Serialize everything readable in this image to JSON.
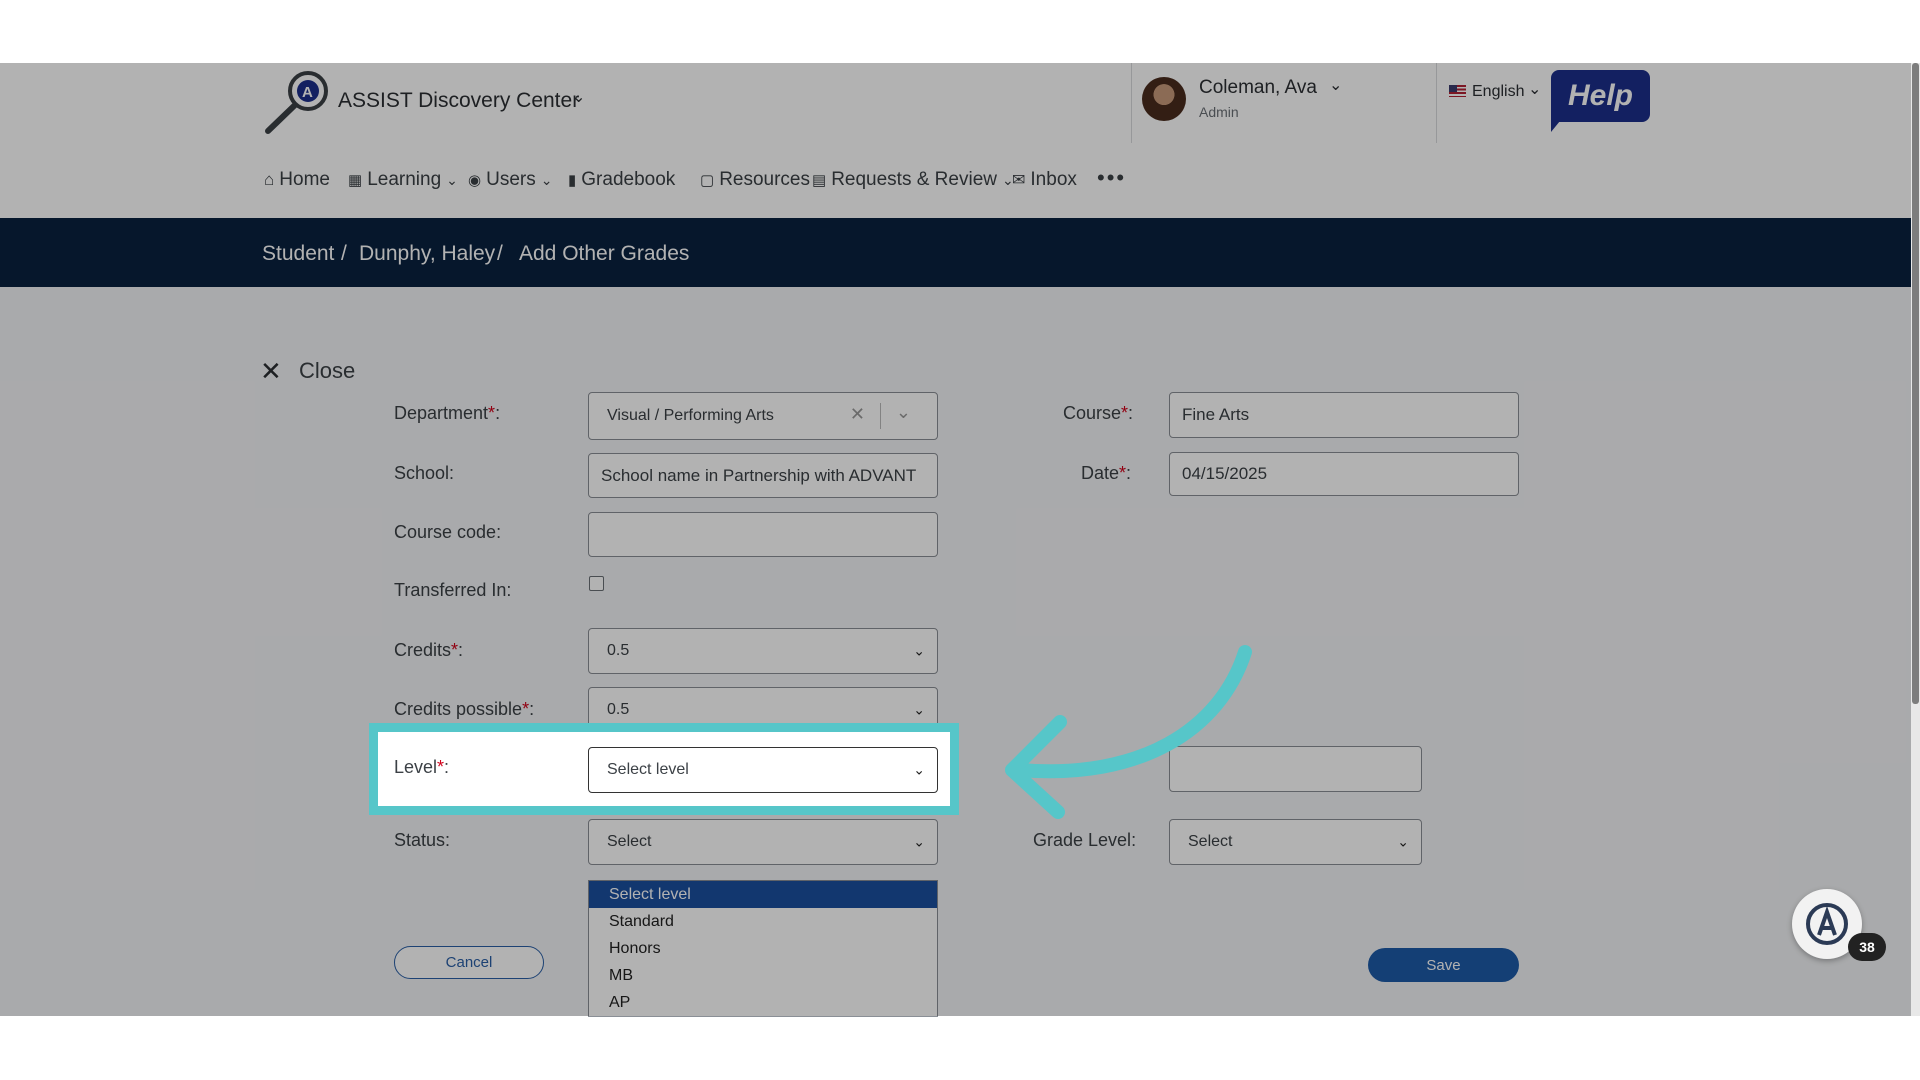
{
  "app": {
    "title": "ASSIST Discovery Center",
    "user_name": "Coleman, Ava",
    "user_role": "Admin",
    "language": "English",
    "help_label": "Help"
  },
  "nav": {
    "items": [
      {
        "label": "Home",
        "icon": "home-icon"
      },
      {
        "label": "Learning",
        "icon": "learning-icon"
      },
      {
        "label": "Users",
        "icon": "users-icon"
      },
      {
        "label": "Gradebook",
        "icon": "gradebook-icon"
      },
      {
        "label": "Resources",
        "icon": "resources-icon"
      },
      {
        "label": "Requests & Review",
        "icon": "requests-icon"
      },
      {
        "label": "Inbox",
        "icon": "inbox-icon"
      }
    ],
    "more": "•••"
  },
  "breadcrumb": {
    "parts": [
      "Student",
      "Dunphy, Haley",
      "Add Other Grades"
    ],
    "sep": "/"
  },
  "form": {
    "close_label": "Close",
    "department": {
      "label": "Department",
      "value": "Visual / Performing Arts"
    },
    "course": {
      "label": "Course",
      "value": "Fine Arts"
    },
    "school": {
      "label": "School",
      "value": "School name in Partnership with ADVANT"
    },
    "date": {
      "label": "Date",
      "value": "04/15/2025"
    },
    "course_code": {
      "label": "Course code",
      "value": ""
    },
    "transferred_in": {
      "label": "Transferred In",
      "checked": false
    },
    "credits": {
      "label": "Credits",
      "value": "0.5"
    },
    "credits_possible": {
      "label": "Credits possible",
      "value": "0.5"
    },
    "level": {
      "label": "Level",
      "value": "Select level"
    },
    "status": {
      "label": "Status",
      "value": "Select"
    },
    "grade_level": {
      "label": "Grade Level",
      "value": "Select"
    },
    "level_options": [
      "Select level",
      "Standard",
      "Honors",
      "MB",
      "AP"
    ],
    "cancel_label": "Cancel",
    "save_label": "Save"
  },
  "widget": {
    "badge": "38"
  },
  "colors": {
    "accent": "#1d5ba8",
    "highlight": "#56c6c9",
    "header": "#0a2240",
    "required": "#d0021b"
  }
}
